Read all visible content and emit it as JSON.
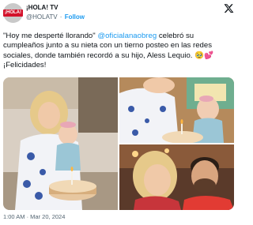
{
  "account": {
    "avatar_text": "¡HOLA!",
    "name": "¡HOLA! TV",
    "handle": "@HOLATV",
    "separator": "·",
    "follow_label": "Follow"
  },
  "tweet": {
    "quote": "\"Hoy me desperté llorando\"",
    "mention": "@oficialanaobreg",
    "body": " celebró su cumpleaños junto a su nieta con un tierno posteo en las redes sociales, donde también recordó a su hijo, Aless Lequio. 🥹💕 ¡Felicidades!",
    "timestamp": "1:00 AM · Mar 20, 2024"
  },
  "media": {
    "photos": [
      "birthday-cake-photo",
      "baby-blowing-candles-photo",
      "couple-selfie-photo"
    ]
  },
  "colors": {
    "link": "#1d9bf0",
    "secondary_text": "#536471",
    "brand_red": "#d3122b"
  },
  "icons": [
    "x-logo-icon"
  ]
}
